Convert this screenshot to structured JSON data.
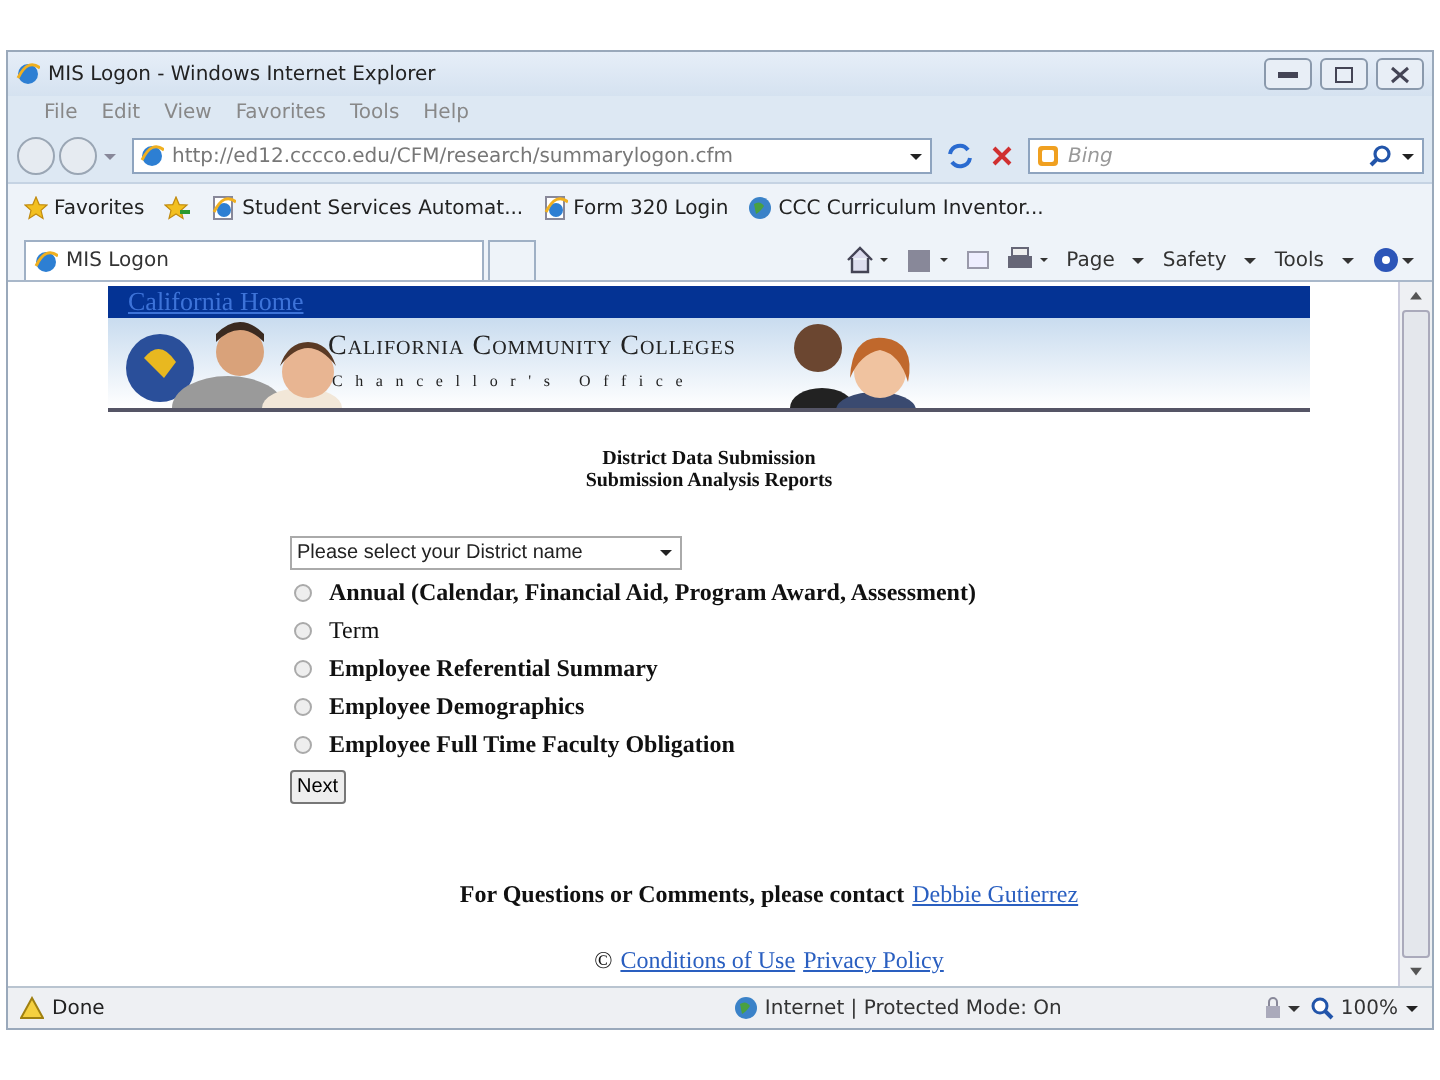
{
  "window": {
    "title": "MIS Logon - Windows Internet Explorer"
  },
  "menu": [
    "File",
    "Edit",
    "View",
    "Favorites",
    "Tools",
    "Help"
  ],
  "address_bar": {
    "url": "http://ed12.cccco.edu/CFM/research/summarylogon.cfm",
    "search_placeholder": "Bing"
  },
  "favorites_bar": {
    "label": "Favorites",
    "links": [
      {
        "label": "Student Services Automat..."
      },
      {
        "label": "Form 320 Login"
      },
      {
        "label": "CCC Curriculum Inventor..."
      }
    ]
  },
  "tabs": [
    {
      "label": "MIS Logon",
      "selected": true
    }
  ],
  "command_bar": [
    "Page",
    "Safety",
    "Tools"
  ],
  "page": {
    "home_link": "California Home",
    "banner": {
      "title": "California Community Colleges",
      "subtitle": "Chancellor's Office"
    },
    "headings": [
      "District Data Submission",
      "Submission Analysis Reports"
    ],
    "district_select": {
      "placeholder": "Please select your District name"
    },
    "options": [
      {
        "label": "Annual (Calendar, Financial Aid, Program Award, Assessment)",
        "bold": true,
        "selected": false
      },
      {
        "label": "Term",
        "bold": false,
        "selected": false
      },
      {
        "label": "Employee Referential Summary",
        "bold": true,
        "selected": false
      },
      {
        "label": "Employee Demographics",
        "bold": true,
        "selected": false
      },
      {
        "label": "Employee Full Time Faculty Obligation",
        "bold": true,
        "selected": false
      }
    ],
    "next_button": "Next",
    "contact": {
      "text": "For Questions or Comments, please contact",
      "link": "Debbie Gutierrez"
    },
    "footer": {
      "symbol": "©",
      "links": [
        "Conditions of Use",
        "Privacy Policy"
      ]
    }
  },
  "status_bar": {
    "text": "Done",
    "zone": "Internet | Protected Mode: On",
    "zoom": "100%"
  }
}
